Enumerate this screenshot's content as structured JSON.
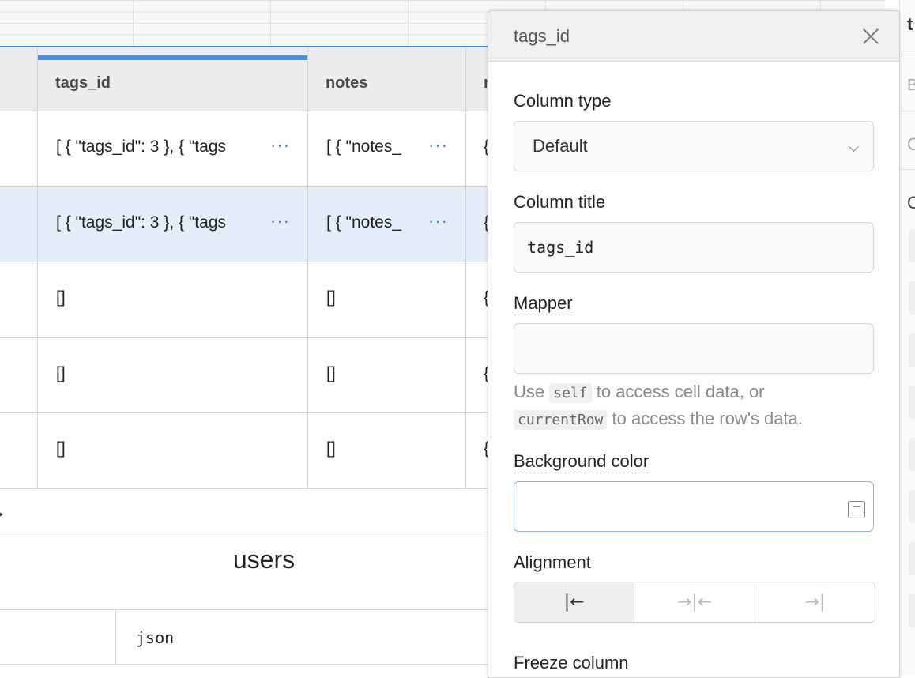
{
  "table": {
    "columns": [
      {
        "label": "",
        "active": false
      },
      {
        "label": "tags_id",
        "active": true
      },
      {
        "label": "notes",
        "active": false
      },
      {
        "label": "n",
        "active": false
      }
    ],
    "rows": [
      {
        "tags": "[ { \"tags_id\": 3 }, { \"tags",
        "notes": "[ { \"notes_",
        "more": "{",
        "selected": false,
        "has_more": true
      },
      {
        "tags": "[ { \"tags_id\": 3 }, { \"tags",
        "notes": "[ { \"notes_",
        "more": "{",
        "selected": true,
        "has_more": true
      },
      {
        "tags": "[]",
        "notes": "[]",
        "more": "{",
        "selected": false,
        "has_more": false
      },
      {
        "tags": "[]",
        "notes": "[]",
        "more": "{",
        "selected": false,
        "has_more": false
      },
      {
        "tags": "[]",
        "notes": "[]",
        "more": "{",
        "selected": false,
        "has_more": false
      }
    ],
    "more_glyph": "···"
  },
  "section": {
    "title": "users",
    "json_label": "json"
  },
  "back_panel": {
    "t": "t",
    "b": "B",
    "c1": "C",
    "c2": "C"
  },
  "panel": {
    "title": "tags_id",
    "column_type_label": "Column type",
    "column_type_value": "Default",
    "column_title_label": "Column title",
    "column_title_value": "tags_id",
    "mapper_label": "Mapper",
    "mapper_value": "",
    "hint_use": "Use",
    "hint_self": "self",
    "hint_mid": "to access cell data, or",
    "hint_current": "currentRow",
    "hint_end": "to access the row's data.",
    "bg_color_label": "Background color",
    "bg_color_value": "",
    "alignment_label": "Alignment",
    "alignment_options": [
      {
        "name": "align-left",
        "glyph": "|←",
        "selected": true
      },
      {
        "name": "align-center",
        "glyph": "→|←",
        "selected": false
      },
      {
        "name": "align-right",
        "glyph": "→|",
        "selected": false
      }
    ],
    "freeze_label": "Freeze column"
  },
  "colors": {
    "accent": "#4a90e2",
    "selected_row": "#e5eef8",
    "header_bg": "#ececec"
  }
}
